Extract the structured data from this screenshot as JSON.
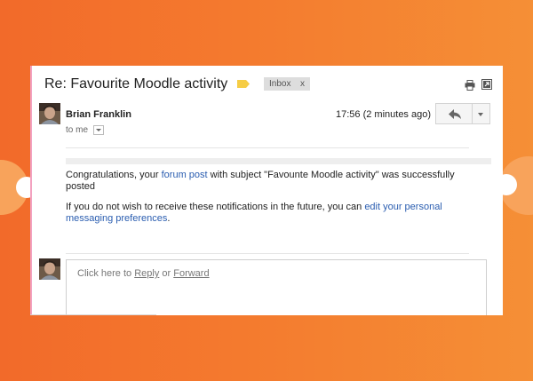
{
  "email": {
    "subject": "Re: Favourite Moodle activity",
    "label_chip": "Inbox",
    "label_chip_close": "x",
    "sender": "Brian Franklin",
    "recipient_line": "to me",
    "time": "17:56 (2 minutes ago)"
  },
  "body": {
    "p1_prefix": "Congratulations, your ",
    "p1_link": "forum post",
    "p1_suffix": " with subject \"Favounte Moodle activity\" was successfully posted",
    "p2_prefix": "If you do not wish to receive these notifications in the future, you can ",
    "p2_link": "edit your personal messaging preferences",
    "p2_suffix": "."
  },
  "compose": {
    "prefix": "Click here to ",
    "reply_link": "Reply",
    "or": " or ",
    "forward_link": "Forward"
  },
  "icons": {
    "label": "label-tag-icon",
    "print": "print-icon",
    "new_window": "new-window-icon",
    "reply": "reply-arrow-icon",
    "more": "chevron-down-icon"
  },
  "colors": {
    "background_from": "#f26a2a",
    "background_to": "#f58f36",
    "label_tag": "#f6cd45",
    "link": "#2a5db0",
    "chip_bg": "#dddddd"
  }
}
